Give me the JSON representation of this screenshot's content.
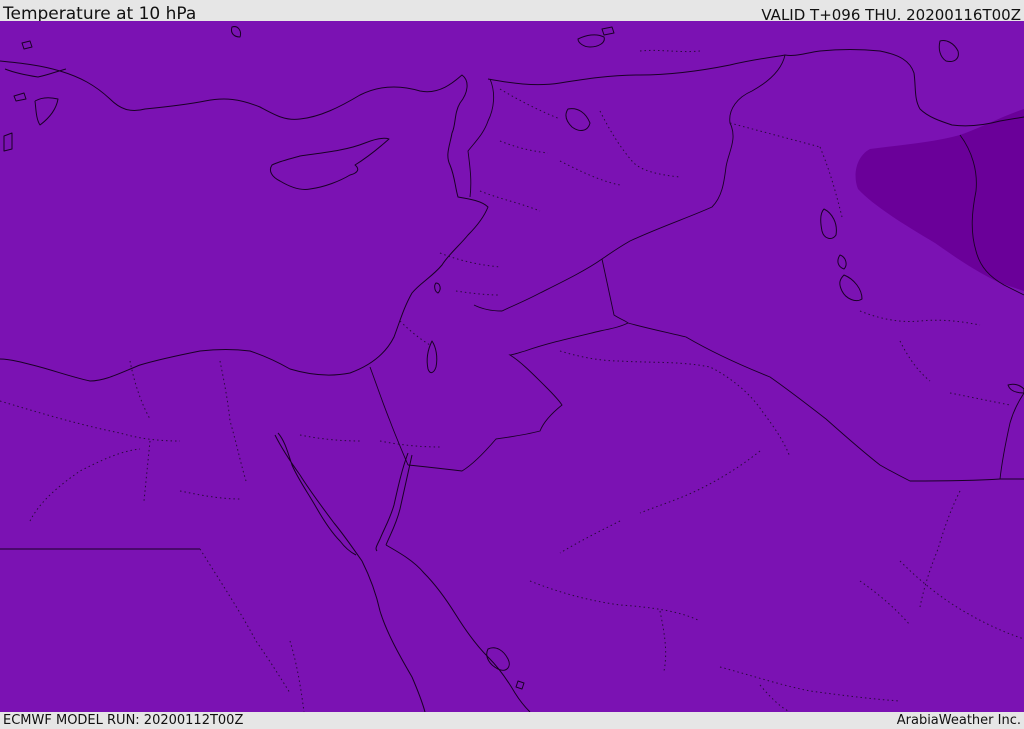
{
  "header": {
    "title": "Temperature at 10 hPa",
    "valid": "VALID T+096 THU. 20200116T00Z"
  },
  "footer": {
    "model_run": "ECMWF MODEL RUN: 20200112T00Z",
    "credit": "ArabiaWeather Inc."
  },
  "map": {
    "base_color": "#7b12b3",
    "cold_region_color": "#6a0099",
    "coastline_color": "#1a0026",
    "region": "Eastern Mediterranean / Middle East"
  }
}
